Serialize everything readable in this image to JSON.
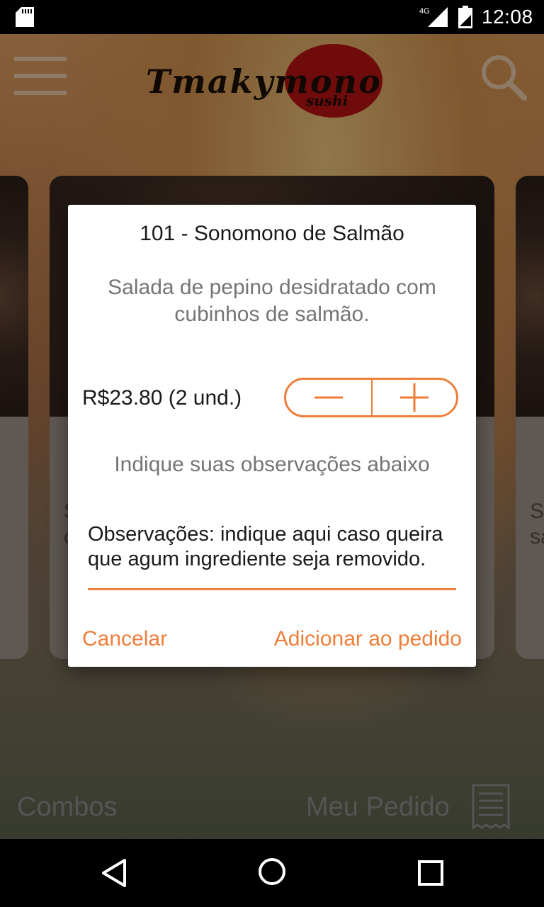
{
  "status_bar": {
    "time": "12:08",
    "network": "4G",
    "icons": [
      "sd-card-icon",
      "signal-icon",
      "battery-icon"
    ]
  },
  "app_bar": {
    "logo_text": "Tmakymono",
    "logo_sub": "sushi",
    "icons": [
      "menu-icon",
      "search-icon"
    ]
  },
  "background": {
    "card_left_text": "",
    "card_right_text_1": "S",
    "card_right_text_2": "sa",
    "card_center_text_1": "S",
    "card_center_text_2": "c"
  },
  "bottom_bar": {
    "combos_label": "Combos",
    "pedido_label": "Meu Pedido"
  },
  "dialog": {
    "title": "101 - Sonomono de Salmão",
    "description": "Salada de pepino desidratado com cubinhos de salmão.",
    "price_text": "R$23.80 (2 und.)",
    "hint": "Indique suas observações abaixo",
    "observations_placeholder": "Observações: indique aqui caso queira que agum ingrediente seja removido.",
    "cancel_label": "Cancelar",
    "add_label": "Adicionar ao pedido"
  },
  "colors": {
    "accent": "#ef7d3a",
    "logo_red": "#b31212"
  },
  "nav_bar": {
    "icons": [
      "back-icon",
      "home-icon",
      "recents-icon"
    ]
  }
}
